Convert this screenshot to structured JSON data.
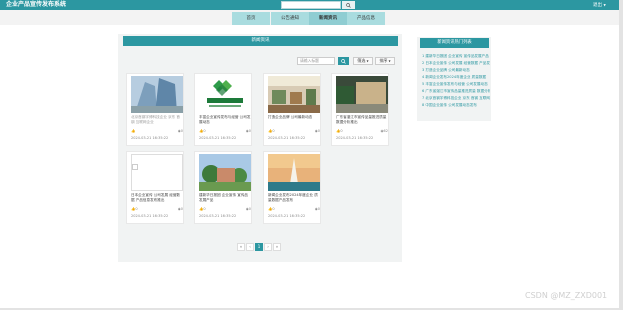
{
  "header": {
    "brand": "企业产品宣传发布系统",
    "search_placeholder": "输入关键词",
    "logout_label": "退出"
  },
  "nav": {
    "tabs": [
      {
        "label": "首页"
      },
      {
        "label": "公告通知"
      },
      {
        "label": "新闻资讯"
      },
      {
        "label": "产品信息"
      }
    ]
  },
  "main": {
    "panel_title": "新闻资讯",
    "search_placeholder": "请输入标题",
    "filter_label": "筛选",
    "sort_label": "排序",
    "cards": [
      {
        "title": "北京首钢宇博科技企业 京东 首钢 互联网企业",
        "likes": "",
        "views": "0",
        "date": "2024-03-21 16:35:22"
      },
      {
        "title": "丰富企业宣传发布与经营 公司发展动态",
        "likes": "0",
        "views": "0",
        "date": "2024-03-21 16:35:22"
      },
      {
        "title": "打造企业品牌 公司最新动态",
        "likes": "0",
        "views": "0",
        "date": "2024-03-21 16:35:22"
      },
      {
        "title": "广东省湛江市宣传品量推进质量 数据分析推出",
        "likes": "0",
        "views": "62",
        "date": "2024-03-21 16:35:22"
      },
      {
        "title": "日本企业宣传 公司发展 经营数据 产品信息发布推出",
        "likes": "0",
        "views": "0",
        "date": "2024-03-21 16:35:22"
      },
      {
        "title": "建新华日报团 企业宣传 宣传品发展产品",
        "likes": "0",
        "views": "0",
        "date": "2024-03-21 16:35:22"
      },
      {
        "title": "新闻企业发布2024年度企业 质量数据产品发布",
        "likes": "0",
        "views": "0",
        "date": "2024-03-21 16:35:22"
      }
    ],
    "pagination": [
      "«",
      "‹",
      "1",
      "›",
      "»"
    ]
  },
  "sidebar": {
    "title": "新闻资讯热门列表",
    "items": [
      "1 建新华日报团 企业宣传 宣传品发展产品",
      "2 日本企业宣传 公司发展 经营数据 产品发布推出",
      "3 打造企业品牌 公司最新动态",
      "4 新闻企业发布2024年度企业 质量数据",
      "5 丰富企业宣传发布与经营 公司发展动态",
      "6 广东省湛江市宣传品量推进质量 数据分析",
      "7 北京首钢宇博科技企业 京东 首钢 互联网企业",
      "8 中国企业宣传 公司发展动态发布"
    ]
  },
  "watermark": "CSDN @MZ_ZXD001",
  "colors": {
    "accent": "#2c97a1",
    "nav_tab": "#a9dcdf",
    "nav_active": "#8fcdd2"
  }
}
